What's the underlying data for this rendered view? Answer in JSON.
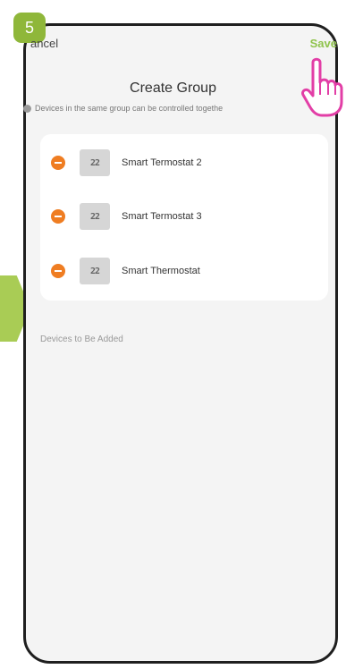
{
  "step_badge": "5",
  "header": {
    "cancel_label": "ancel",
    "save_label": "Save",
    "title": "Create Group",
    "info_text": "Devices in the same group can be controlled togethe"
  },
  "devices": [
    {
      "name": "Smart Termostat 2",
      "display": "22"
    },
    {
      "name": "Smart Termostat 3",
      "display": "22"
    },
    {
      "name": "Smart Thermostat",
      "display": "22"
    }
  ],
  "section": {
    "to_add_label": "Devices to Be Added"
  },
  "colors": {
    "accent_green": "#8fb73a",
    "save_green": "#8fc34c",
    "remove_orange": "#ef7d22",
    "hand_pink": "#e23ea6"
  },
  "icons": {
    "info": "info-circle-icon",
    "remove": "remove-circle-icon",
    "thermostat": "thermostat-icon",
    "pointer": "hand-pointer-icon"
  }
}
